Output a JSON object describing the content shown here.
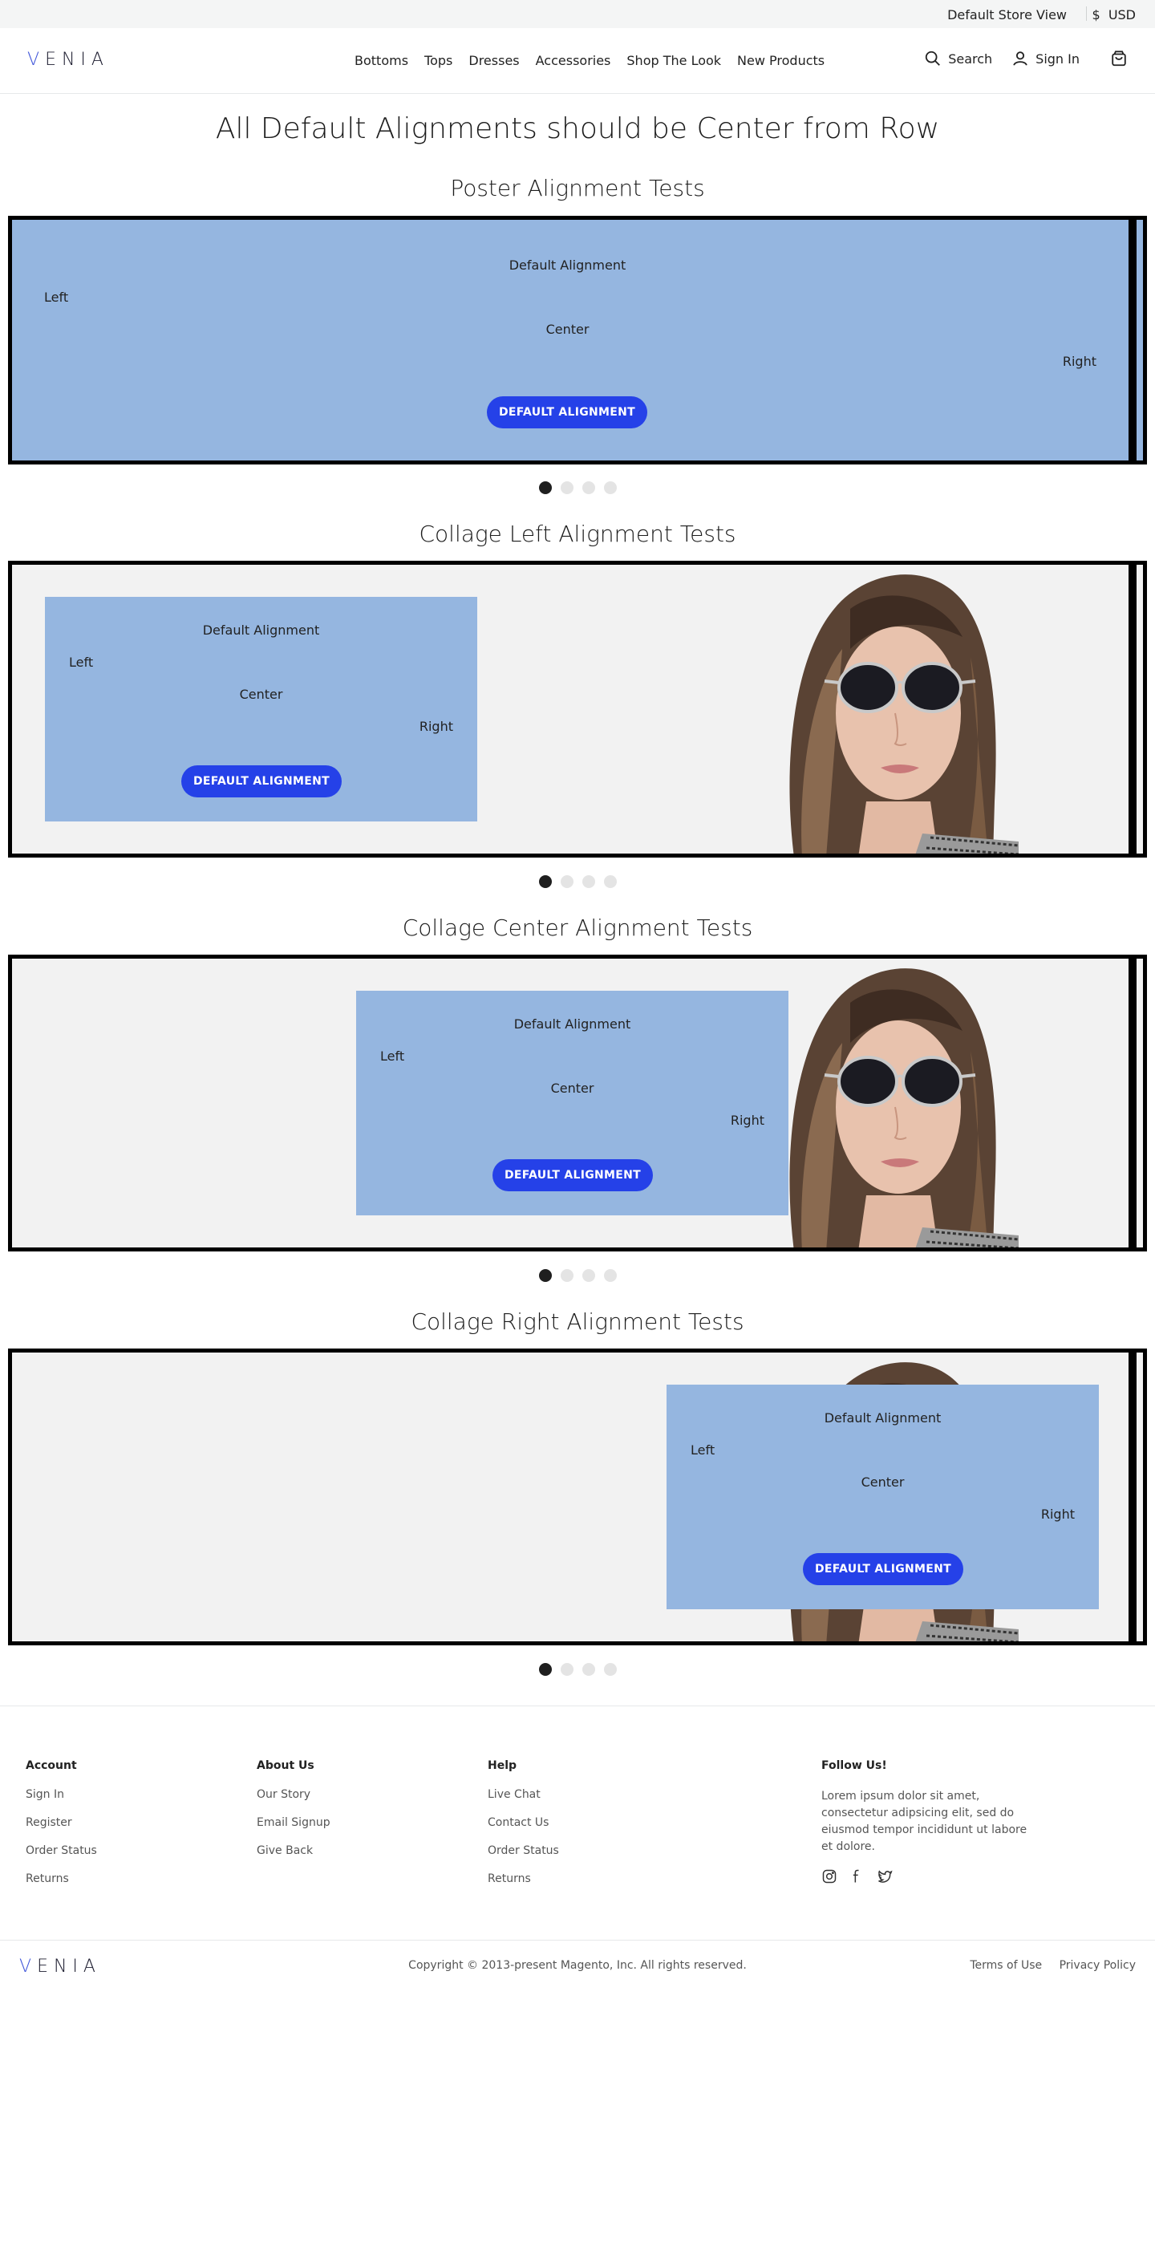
{
  "topbar": {
    "store": "Default Store View",
    "currency_symbol": "$",
    "currency": "USD"
  },
  "header": {
    "logo": "VENIA",
    "nav": [
      "Bottoms",
      "Tops",
      "Dresses",
      "Accessories",
      "Shop The Look",
      "New Products"
    ],
    "search_label": "Search",
    "signin_label": "Sign In"
  },
  "page_title": "All Default Alignments should be Center from Row",
  "sections": [
    {
      "title": "Poster Alignment Tests",
      "default_text": "Default Alignment",
      "left_text": "Left",
      "center_text": "Center",
      "right_text": "Right",
      "button": "DEFAULT ALIGNMENT",
      "active_slide": 1,
      "slides": 4
    },
    {
      "title": "Collage Left Alignment Tests",
      "default_text": "Default Alignment",
      "left_text": "Left",
      "center_text": "Center",
      "right_text": "Right",
      "button": "DEFAULT ALIGNMENT",
      "active_slide": 1,
      "slides": 4
    },
    {
      "title": "Collage Center Alignment Tests",
      "default_text": "Default Alignment",
      "left_text": "Left",
      "center_text": "Center",
      "right_text": "Right",
      "button": "DEFAULT ALIGNMENT",
      "active_slide": 1,
      "slides": 4
    },
    {
      "title": "Collage Right Alignment Tests",
      "default_text": "Default Alignment",
      "left_text": "Left",
      "center_text": "Center",
      "right_text": "Right",
      "button": "DEFAULT ALIGNMENT",
      "active_slide": 1,
      "slides": 4
    }
  ],
  "footer": {
    "account": {
      "heading": "Account",
      "links": [
        "Sign In",
        "Register",
        "Order Status",
        "Returns"
      ]
    },
    "about": {
      "heading": "About Us",
      "links": [
        "Our Story",
        "Email Signup",
        "Give Back"
      ]
    },
    "help": {
      "heading": "Help",
      "links": [
        "Live Chat",
        "Contact Us",
        "Order Status",
        "Returns"
      ]
    },
    "follow": {
      "heading": "Follow Us!",
      "text": "Lorem ipsum dolor sit amet, consectetur adipsicing elit, sed do eiusmod tempor incididunt ut labore et dolore.",
      "icons": [
        "instagram-icon",
        "facebook-icon",
        "twitter-icon"
      ]
    },
    "logo": "VENIA",
    "copyright": "Copyright © 2013-present Magento, Inc. All rights reserved.",
    "terms": "Terms of Use",
    "privacy": "Privacy Policy"
  },
  "colors": {
    "banner_blue": "#95b6e0",
    "button_blue": "#2541e8",
    "frame": "#000000"
  }
}
